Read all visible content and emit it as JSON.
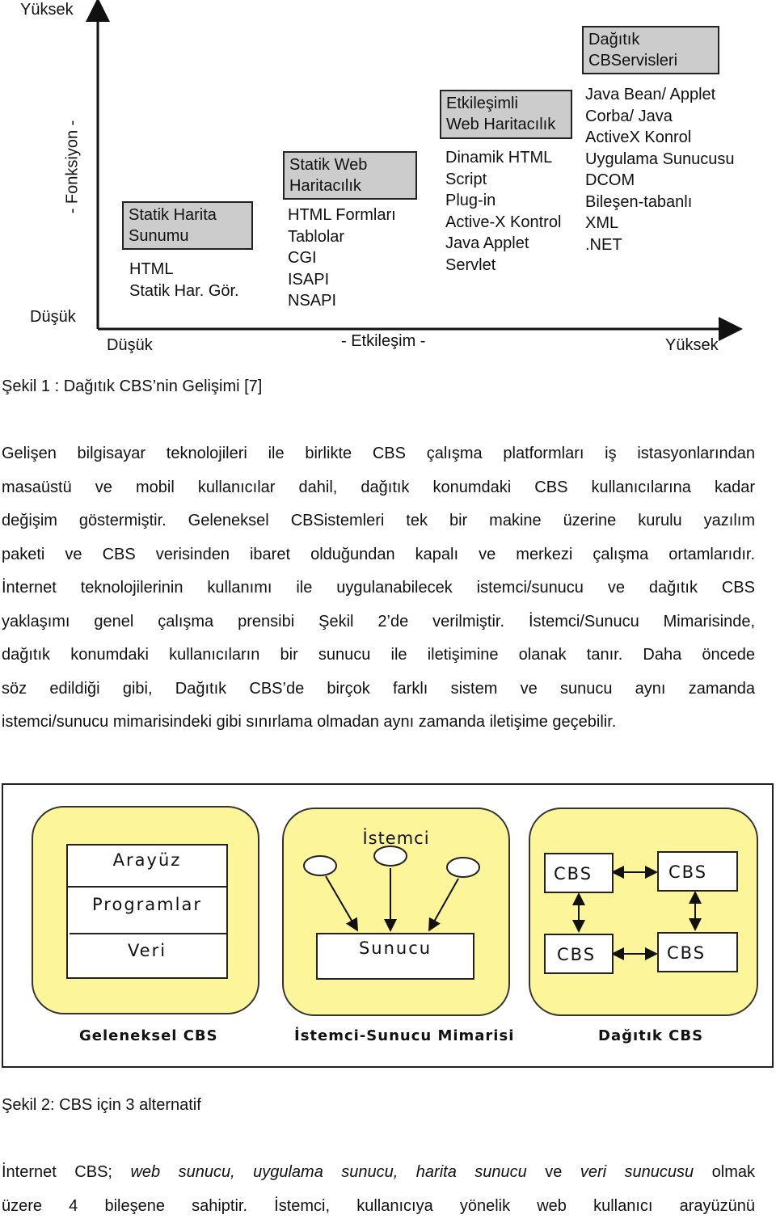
{
  "figure1": {
    "y_axis": {
      "high": "Yüksek",
      "low": "Düşük",
      "title": "- Fonksiyon -"
    },
    "x_axis": {
      "low": "Düşük",
      "high": "Yüksek",
      "title": "- Etkileşim -"
    },
    "stages": [
      {
        "title_lines": [
          "Statik  Harita",
          "Sunumu"
        ],
        "items": [
          "HTML",
          "Statik Har. Gör."
        ]
      },
      {
        "title_lines": [
          "Statik  Web",
          "Haritacılık"
        ],
        "items": [
          "HTML Formları",
          "Tablolar",
          "CGI",
          "ISAPI",
          "NSAPI"
        ]
      },
      {
        "title_lines": [
          "Etkileşimli",
          "Web Haritacılık"
        ],
        "items": [
          "Dinamik HTML",
          "Script",
          "Plug-in",
          "Active-X Kontrol",
          "Java Applet",
          "Servlet"
        ]
      },
      {
        "title_lines": [
          "Dağıtık",
          "CBServisleri"
        ],
        "items": [
          "Java Bean/ Applet",
          "Corba/ Java",
          "ActiveX Konrol",
          "Uygulama Sunucusu",
          "DCOM",
          "Bileşen-tabanlı",
          "XML",
          ".NET"
        ]
      }
    ],
    "caption": "Şekil 1 : Dağıtık CBS’nin Gelişimi [7]"
  },
  "paragraph1": {
    "lines": [
      "Gelişen bilgisayar teknolojileri ile birlikte CBS çalışma platformları iş istasyonlarından",
      "masaüstü ve mobil kullanıcılar dahil, dağıtık konumdaki CBS kullanıcılarına kadar",
      "değişim göstermiştir. Geleneksel CBSistemleri tek bir makine üzerine kurulu yazılım",
      "paketi ve CBS verisinden ibaret olduğundan kapalı ve merkezi çalışma ortamlarıdır.",
      "İnternet teknolojilerinin kullanımı ile uygulanabilecek istemci/sunucu ve dağıtık CBS",
      "yaklaşımı genel çalışma prensibi Şekil 2’de verilmiştir. İstemci/Sunucu Mimarisinde,",
      "dağıtık konumdaki kullanıcıların bir sunucu ile iletişimine olanak tanır. Daha öncede",
      "söz edildiği gibi, Dağıtık CBS’de birçok farklı sistem ve sunucu aynı zamanda",
      "istemci/sunucu mimarisindeki gibi sınırlama olmadan aynı zamanda iletişime geçebilir."
    ]
  },
  "figure2": {
    "panels": [
      {
        "label": "Geleneksel CBS",
        "layers": [
          "Arayüz",
          "Programlar",
          "Veri"
        ]
      },
      {
        "label": "İstemci-Sunucu Mimarisi",
        "client_label": "İstemci",
        "server_label": "Sunucu"
      },
      {
        "label": "Dağıtık CBS",
        "nodes": [
          "CBS",
          "CBS",
          "CBS",
          "CBS"
        ]
      }
    ],
    "fill_color": "#fdf59a",
    "caption": "Şekil 2: CBS için 3 alternatif"
  },
  "paragraph2": {
    "line1": {
      "t1": "İnternet CBS; ",
      "i1": "web sunucu, uygulama sunucu, harita sunucu",
      "t2": " ve ",
      "i2": "veri sunucusu",
      "t3": " olmak"
    },
    "line2": "üzere 4 bileşene sahiptir. İstemci, kullanıcıya yönelik web kullanıcı arayüzünü"
  }
}
